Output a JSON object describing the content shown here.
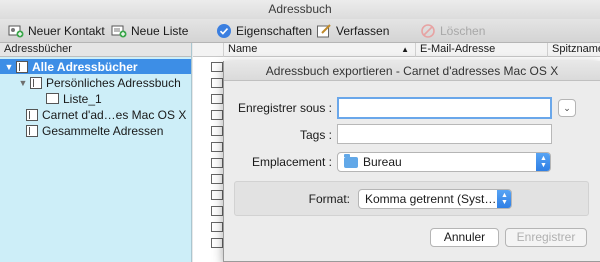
{
  "window": {
    "title": "Adressbuch"
  },
  "toolbar": {
    "new_contact": "Neuer Kontakt",
    "new_list": "Neue Liste",
    "properties": "Eigenschaften",
    "compose": "Verfassen",
    "delete": "Löschen"
  },
  "sidebar": {
    "header": "Adressbücher",
    "items": [
      {
        "label": "Alle Adressbücher",
        "selected": true
      },
      {
        "label": "Persönliches Adressbuch"
      },
      {
        "label": "Liste_1"
      },
      {
        "label": "Carnet d'ad…es Mac OS X"
      },
      {
        "label": "Gesammelte Adressen"
      }
    ]
  },
  "contacts": {
    "columns": [
      "Name",
      "E-Mail-Adresse",
      "Spitzname"
    ]
  },
  "dialog": {
    "title": "Adressbuch exportieren - Carnet d'adresses Mac OS X",
    "save_as_label": "Enregistrer sous :",
    "save_as_value": "",
    "tags_label": "Tags :",
    "tags_value": "",
    "location_label": "Emplacement :",
    "location_value": "Bureau",
    "format_label": "Format:",
    "format_value": "Komma getrennt (Syst…",
    "cancel": "Annuler",
    "save": "Enregistrer"
  },
  "colors": {
    "selection": "#3d8ee6",
    "sidebar_bg": "#cdeef8",
    "focus_ring": "#6aa7ea",
    "accent": "#2c7de4"
  }
}
